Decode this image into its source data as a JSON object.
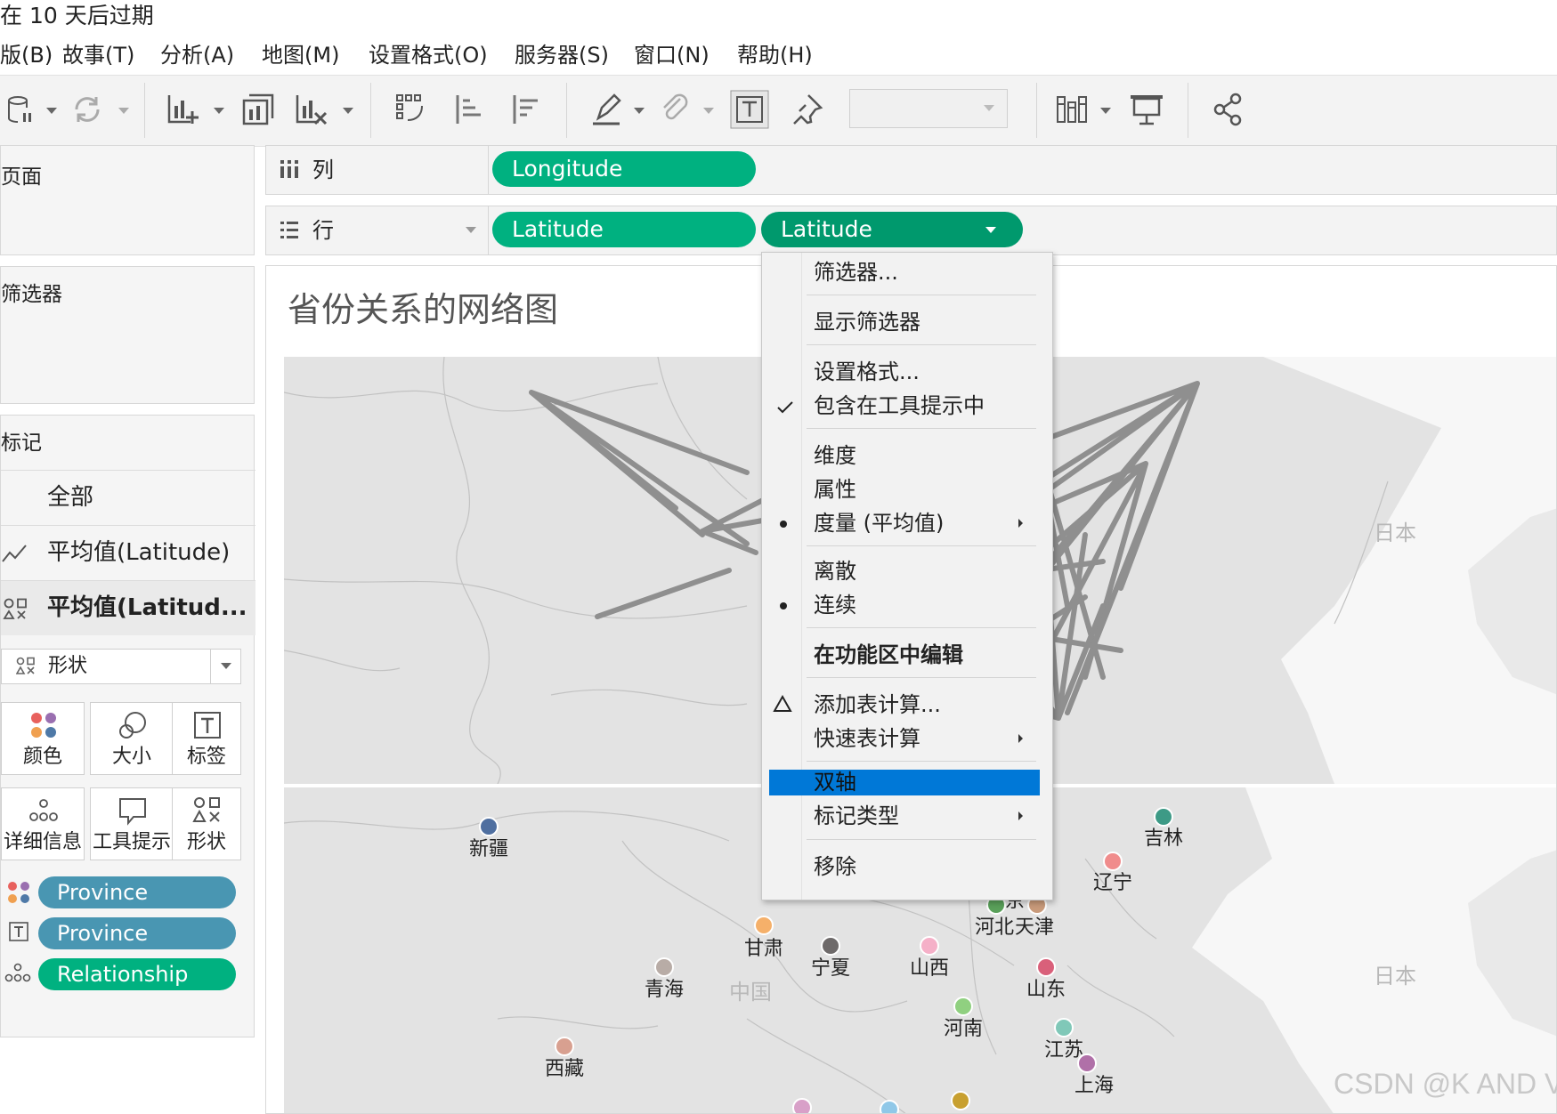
{
  "titlebar": {
    "text": "在 10 天后过期"
  },
  "menu": [
    "版(B)",
    "故事(T)",
    "分析(A)",
    "地图(M)",
    "设置格式(O)",
    "服务器(S)",
    "窗口(N)",
    "帮助(H)"
  ],
  "panels": {
    "pages": "页面",
    "filters": "筛选器",
    "marks": "标记"
  },
  "marks_card": {
    "rows": [
      "全部",
      "平均值(Latitude)",
      "平均值(Latitud..."
    ],
    "mark_type": "形状",
    "buttons": [
      "颜色",
      "大小",
      "标签",
      "详细信息",
      "工具提示",
      "形状"
    ],
    "pills": [
      "Province",
      "Province",
      "Relationship"
    ]
  },
  "shelves": {
    "columns_label": "列",
    "rows_label": "行",
    "columns_pills": [
      "Longitude"
    ],
    "rows_pills": [
      "Latitude",
      "Latitude"
    ]
  },
  "view": {
    "title": "省份关系的网络图",
    "map_labels": {
      "japan_top": "日本",
      "japan_bottom": "日本",
      "china": "中国"
    },
    "provinces": [
      {
        "name": "新疆",
        "color": "#4f6fa0"
      },
      {
        "name": "吉林",
        "color": "#3d9a86"
      },
      {
        "name": "辽宁",
        "color": "#f08c8c"
      },
      {
        "name": "北京",
        "color": "#4f6fa0"
      },
      {
        "name": "河北",
        "color": "#5aa05a"
      },
      {
        "name": "天津",
        "color": "#c89a7a"
      },
      {
        "name": "甘肃",
        "color": "#f5b06a"
      },
      {
        "name": "宁夏",
        "color": "#6e6a6a"
      },
      {
        "name": "山西",
        "color": "#f5b0c8"
      },
      {
        "name": "山东",
        "color": "#d9607a"
      },
      {
        "name": "青海",
        "color": "#b8aca6"
      },
      {
        "name": "河南",
        "color": "#90d080"
      },
      {
        "name": "江苏",
        "color": "#80c8b8"
      },
      {
        "name": "西藏",
        "color": "#d8a090"
      },
      {
        "name": "上海",
        "color": "#b070a8"
      }
    ]
  },
  "context_menu": {
    "items": [
      "筛选器...",
      "显示筛选器",
      "设置格式...",
      "包含在工具提示中",
      "维度",
      "属性",
      "度量 (平均值)",
      "离散",
      "连续",
      "在功能区中编辑",
      "添加表计算...",
      "快速表计算",
      "双轴",
      "标记类型",
      "移除"
    ],
    "highlighted": "双轴"
  },
  "watermark": "CSDN @K AND V",
  "colors": {
    "accent_green": "#00b180",
    "pill_blue": "#4996b2",
    "highlight": "#0078d7",
    "dark_green": "#00996d"
  }
}
